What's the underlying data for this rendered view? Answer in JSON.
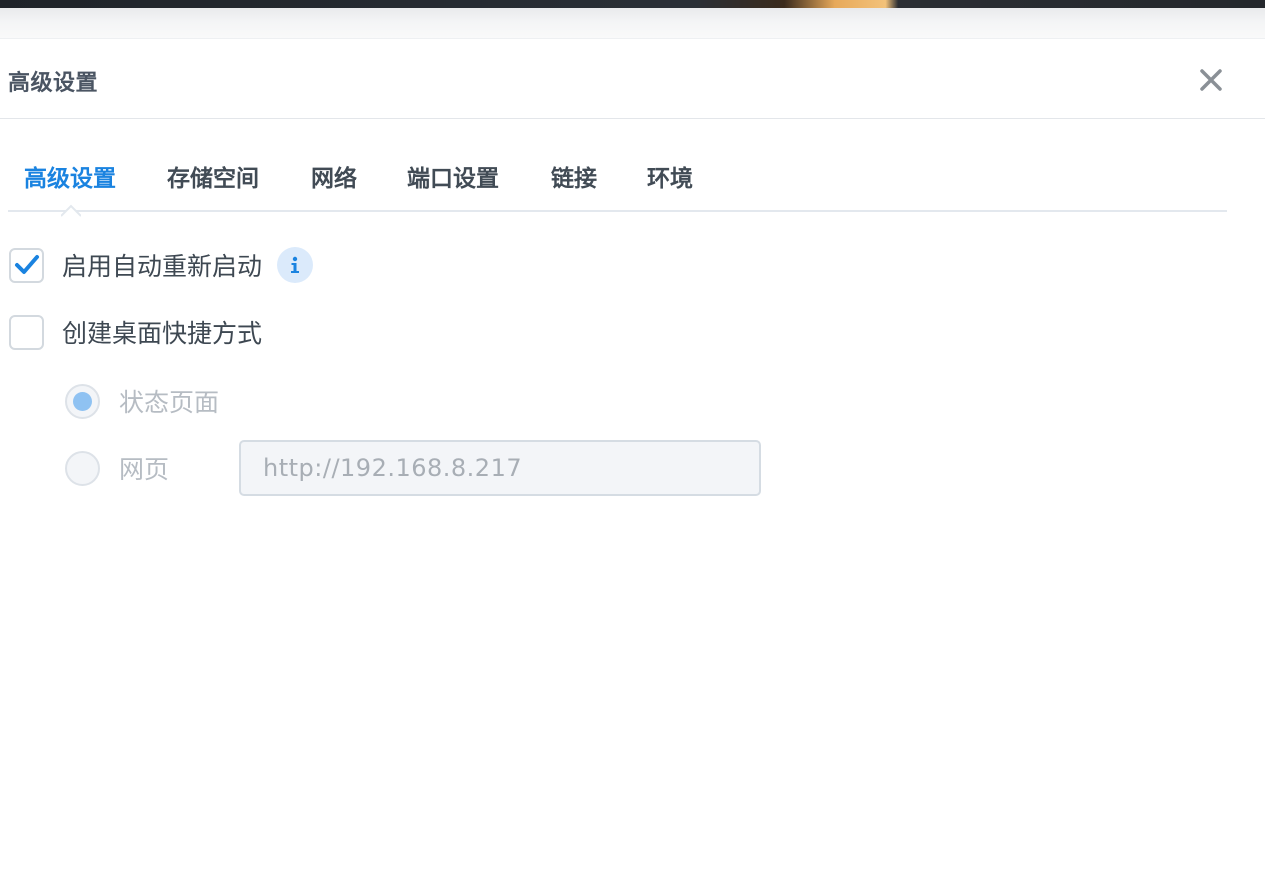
{
  "dialog": {
    "title": "高级设置"
  },
  "tabs": [
    {
      "label": "高级设置",
      "active": true
    },
    {
      "label": "存储空间",
      "active": false
    },
    {
      "label": "网络",
      "active": false
    },
    {
      "label": "端口设置",
      "active": false
    },
    {
      "label": "链接",
      "active": false
    },
    {
      "label": "环境",
      "active": false
    }
  ],
  "options": {
    "auto_restart": {
      "label": "启用自动重新启动",
      "checked": true
    },
    "desktop_shortcut": {
      "label": "创建桌面快捷方式",
      "checked": false
    }
  },
  "shortcut_type": {
    "status_page": {
      "label": "状态页面",
      "selected": true
    },
    "web_page": {
      "label": "网页",
      "selected": false
    },
    "url_value": "http://192.168.8.217"
  },
  "colors": {
    "accent": "#1a83e0",
    "text": "#3e4852",
    "disabled_text": "#b6bcc3"
  },
  "icons": [
    "close-icon",
    "checkmark-icon",
    "info-icon",
    "tab-caret-icon"
  ]
}
